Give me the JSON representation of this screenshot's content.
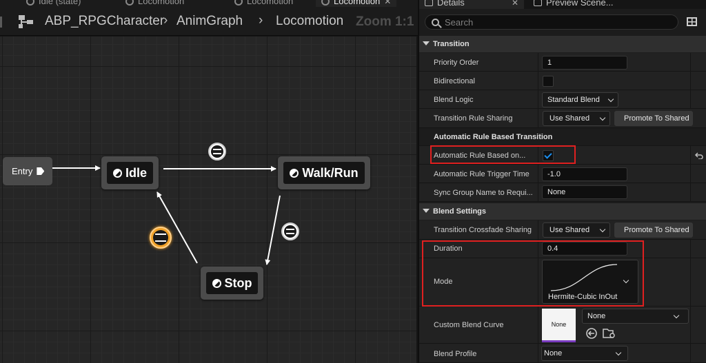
{
  "editor_tabs": [
    {
      "label": "Idle (state)"
    },
    {
      "label": "Locomotion"
    },
    {
      "label": "Locomotion"
    },
    {
      "label": "Locomotion"
    }
  ],
  "breadcrumb": {
    "asset": "ABP_RPGCharacter",
    "graph": "AnimGraph",
    "state_machine": "Locomotion",
    "zoom": "Zoom 1:1"
  },
  "graph": {
    "entry_label": "Entry",
    "states": {
      "idle": "Idle",
      "walk_run": "Walk/Run",
      "stop": "Stop"
    }
  },
  "details": {
    "tabs": [
      {
        "label": "Details"
      },
      {
        "label": "Preview Scene..."
      }
    ],
    "search_placeholder": "Search",
    "sections": {
      "transition": "Transition",
      "blend_settings": "Blend Settings"
    },
    "transition": {
      "priority_order_label": "Priority Order",
      "priority_order_value": "1",
      "bidirectional_label": "Bidirectional",
      "blend_logic_label": "Blend Logic",
      "blend_logic_value": "Standard Blend",
      "rule_sharing_label": "Transition Rule Sharing",
      "rule_sharing_value": "Use Shared",
      "promote_label": "Promote To Shared",
      "auto_rule_header": "Automatic Rule Based Transition",
      "auto_rule_label": "Automatic Rule Based on...",
      "auto_rule_checked": true,
      "trigger_time_label": "Automatic Rule Trigger Time",
      "trigger_time_value": "-1.0",
      "sync_group_label": "Sync Group Name to Requi...",
      "sync_group_value": "None"
    },
    "blend": {
      "crossfade_label": "Transition Crossfade Sharing",
      "crossfade_value": "Use Shared",
      "promote_label": "Promote To Shared",
      "duration_label": "Duration",
      "duration_value": "0.4",
      "mode_label": "Mode",
      "mode_value": "Hermite-Cubic InOut",
      "custom_curve_label": "Custom Blend Curve",
      "custom_curve_thumb": "None",
      "custom_curve_value": "None",
      "profile_label": "Blend Profile",
      "profile_value": "None"
    }
  },
  "colors": {
    "highlight_box": "#e02020",
    "active_transition": "#f2a32a",
    "checkbox_tick": "#1a8ff0"
  }
}
